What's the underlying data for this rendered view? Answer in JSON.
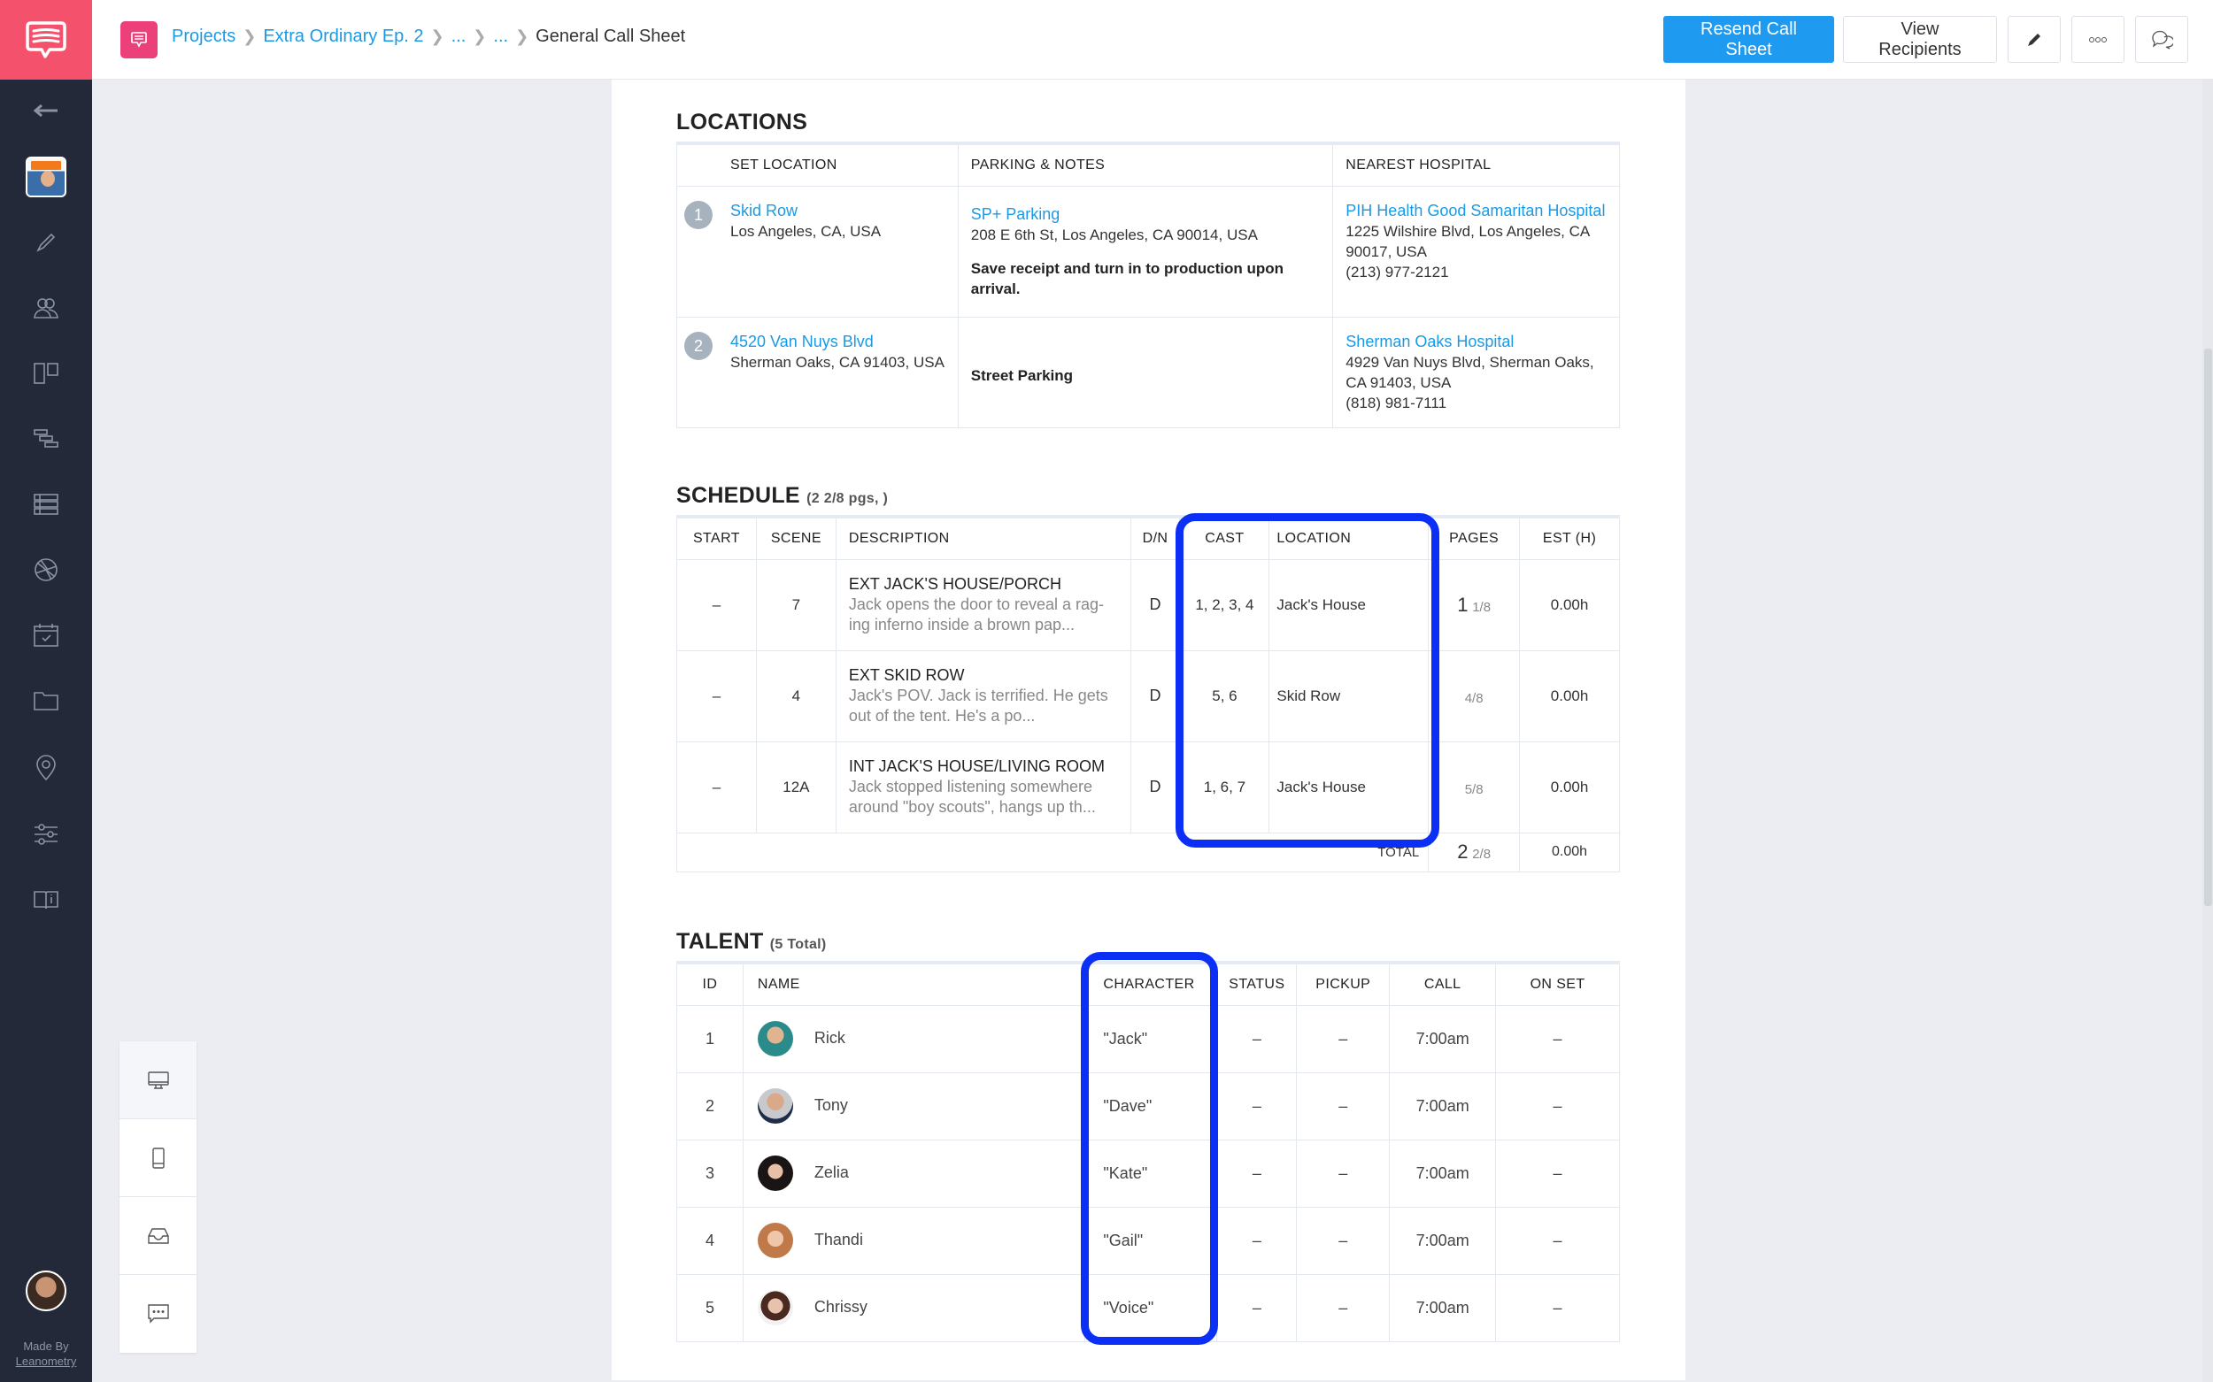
{
  "app": {
    "made_by": "Made By",
    "made_by_link": "Leanometry"
  },
  "breadcrumb": {
    "items": [
      "Projects",
      "Extra Ordinary Ep. 2",
      "...",
      "..."
    ],
    "current": "General Call Sheet"
  },
  "toolbar": {
    "resend_label": "Resend Call Sheet",
    "view_recipients_label": "View Recipients",
    "accent_color": "#1e9bf0"
  },
  "sidebar": {
    "items": [
      "back-arrow",
      "project-thumbnail",
      "write",
      "contacts",
      "storyboard",
      "scheduling",
      "shot-list",
      "camera",
      "calendar",
      "folder",
      "locations",
      "settings",
      "guide"
    ]
  },
  "locations": {
    "title": "LOCATIONS",
    "headers": [
      "SET LOCATION",
      "PARKING & NOTES",
      "NEAREST HOSPITAL"
    ],
    "rows": [
      {
        "num": "1",
        "set_name": "Skid Row",
        "set_address": "Los Angeles, CA, USA",
        "parking_name": "SP+ Parking",
        "parking_address": "208 E 6th St, Los Angeles, CA 90014, USA",
        "note": "Save receipt and turn in to production upon arrival.",
        "hospital_name": "PIH Health Good Samaritan Hospital",
        "hospital_address": "1225 Wilshire Blvd, Los Angeles, CA 90017, USA",
        "hospital_phone": "(213) 977-2121"
      },
      {
        "num": "2",
        "set_name": "4520 Van Nuys Blvd",
        "set_address": "Sherman Oaks, CA 91403, USA",
        "parking_name": "",
        "parking_address": "",
        "note": "Street Parking",
        "hospital_name": "Sherman Oaks Hospital",
        "hospital_address": "4929 Van Nuys Blvd, Sherman Oaks, CA 91403, USA",
        "hospital_phone": "(818) 981-7111"
      }
    ]
  },
  "schedule": {
    "title": "SCHEDULE",
    "subtitle": "(2 2/8 pgs, )",
    "headers": [
      "START",
      "SCENE",
      "DESCRIPTION",
      "D/N",
      "CAST",
      "LOCATION",
      "PAGES",
      "EST (H)"
    ],
    "rows": [
      {
        "start": "–",
        "scene": "7",
        "heading": "EXT JACK'S HOUSE/PORCH",
        "desc": "Jack opens the door to reveal a rag-ing inferno inside a brown pap...",
        "dn": "D",
        "cast": "1, 2, 3, 4",
        "location": "Jack's House",
        "pages_whole": "1",
        "pages_frac": "1/8",
        "est": "0.00h"
      },
      {
        "start": "–",
        "scene": "4",
        "heading": "EXT SKID ROW",
        "desc": "Jack's POV. Jack is terrified. He gets out of the tent. He's a po...",
        "dn": "D",
        "cast": "5, 6",
        "location": "Skid Row",
        "pages_whole": "",
        "pages_frac": "4/8",
        "est": "0.00h"
      },
      {
        "start": "–",
        "scene": "12A",
        "heading": "INT JACK'S HOUSE/LIVING ROOM",
        "desc": "Jack stopped listening somewhere around \"boy scouts\", hangs up th...",
        "dn": "D",
        "cast": "1, 6, 7",
        "location": "Jack's House",
        "pages_whole": "",
        "pages_frac": "5/8",
        "est": "0.00h"
      }
    ],
    "total_label": "TOTAL",
    "total_pages_whole": "2",
    "total_pages_frac": "2/8",
    "total_est": "0.00h"
  },
  "talent": {
    "title": "TALENT",
    "subtitle": "(5 Total)",
    "headers": [
      "ID",
      "NAME",
      "CHARACTER",
      "STATUS",
      "PICKUP",
      "CALL",
      "ON SET"
    ],
    "rows": [
      {
        "id": "1",
        "name": "Rick",
        "character": "\"Jack\"",
        "status": "–",
        "pickup": "–",
        "call": "7:00am",
        "on_set": "–"
      },
      {
        "id": "2",
        "name": "Tony",
        "character": "\"Dave\"",
        "status": "–",
        "pickup": "–",
        "call": "7:00am",
        "on_set": "–"
      },
      {
        "id": "3",
        "name": "Zelia",
        "character": "\"Kate\"",
        "status": "–",
        "pickup": "–",
        "call": "7:00am",
        "on_set": "–"
      },
      {
        "id": "4",
        "name": "Thandi",
        "character": "\"Gail\"",
        "status": "–",
        "pickup": "–",
        "call": "7:00am",
        "on_set": "–"
      },
      {
        "id": "5",
        "name": "Chrissy",
        "character": "\"Voice\"",
        "status": "–",
        "pickup": "–",
        "call": "7:00am",
        "on_set": "–"
      }
    ]
  },
  "view_panel": {
    "items": [
      "desktop-view",
      "mobile-view",
      "inbox-view",
      "comments-view"
    ]
  },
  "colors": {
    "brand": "#f4516c",
    "link": "#1a9ae6",
    "highlight": "#0c2ff5",
    "sidebar": "#232938"
  }
}
